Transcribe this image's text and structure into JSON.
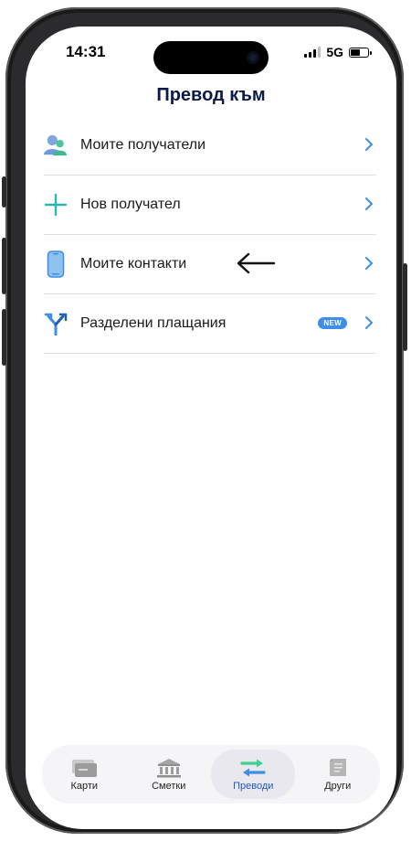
{
  "status": {
    "time": "14:31",
    "network": "5G",
    "battery_level": 0.6
  },
  "header": {
    "title": "Превод към"
  },
  "menu": {
    "items": [
      {
        "label": "Моите получатели",
        "icon": "people-icon"
      },
      {
        "label": "Нов получател",
        "icon": "plus-icon"
      },
      {
        "label": "Моите контакти",
        "icon": "phone-icon"
      },
      {
        "label": "Разделени плащания",
        "icon": "split-icon",
        "badge": "NEW"
      }
    ]
  },
  "tabbar": {
    "tabs": [
      {
        "label": "Карти",
        "icon": "card-icon",
        "active": false
      },
      {
        "label": "Сметки",
        "icon": "bank-icon",
        "active": false
      },
      {
        "label": "Преводи",
        "icon": "transfer-icon",
        "active": true
      },
      {
        "label": "Други",
        "icon": "document-icon",
        "active": false
      }
    ]
  },
  "colors": {
    "accent": "#3d8ee6",
    "title": "#0b1a4a",
    "active_tab": "#2456c4",
    "teal": "#2bb7b0"
  }
}
